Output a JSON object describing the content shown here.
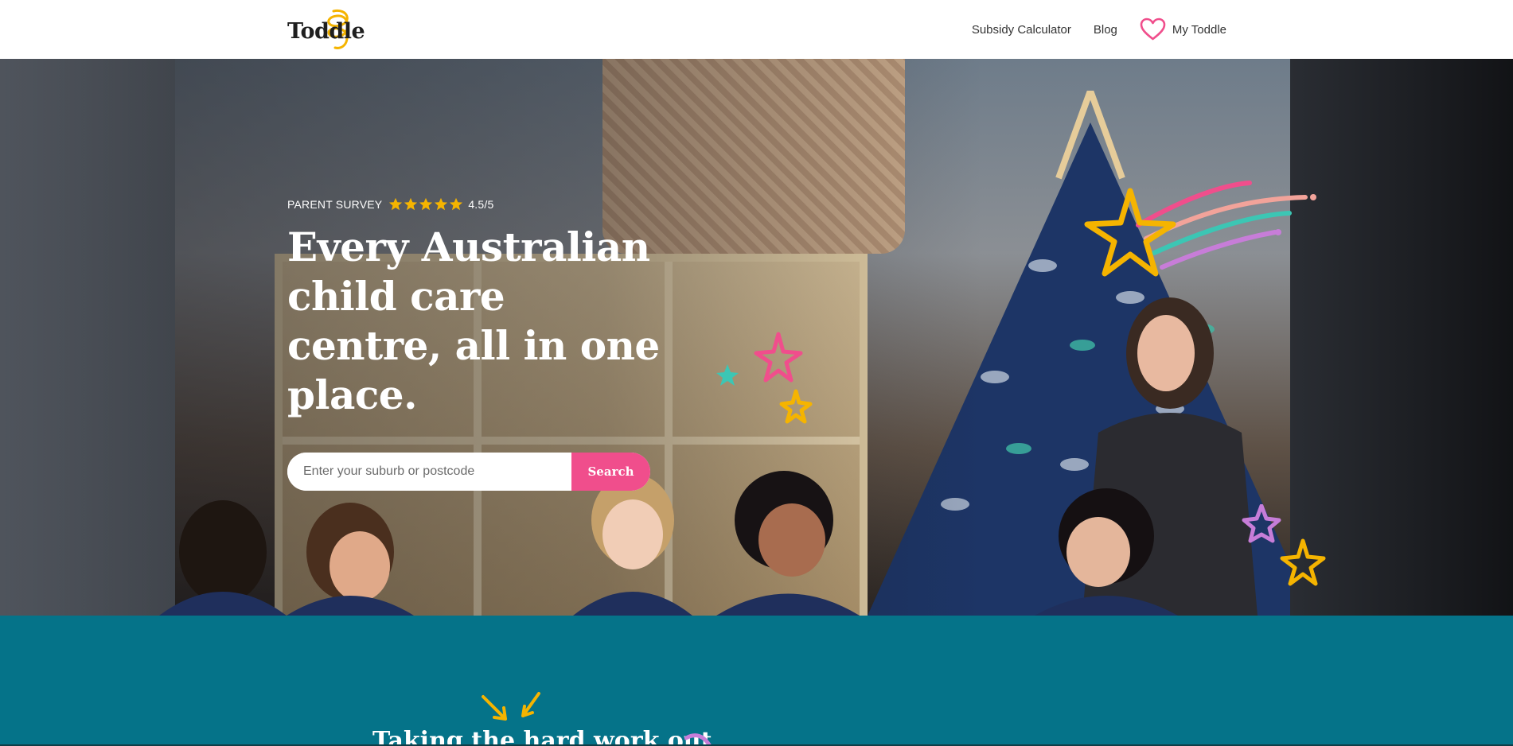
{
  "nav": {
    "logo_text": "Toddle",
    "links": [
      {
        "label": "Subsidy Calculator"
      },
      {
        "label": "Blog"
      }
    ],
    "my_toddle_label": "My Toddle",
    "heart_color": "#f04e8c"
  },
  "hero": {
    "survey_label": "PARENT SURVEY",
    "rating": "4.5/5",
    "rating_value": 4.5,
    "rating_max": 5,
    "star_color": "#f5b400",
    "headline": "Every Australian child care centre, all in one place.",
    "search": {
      "placeholder": "Enter your suburb or postcode",
      "button_label": "Search",
      "button_color": "#f04e8c"
    }
  },
  "section": {
    "title_partial": "Taking the hard work out",
    "background_color": "#057389"
  },
  "colors": {
    "accent_pink": "#f04e8c",
    "accent_yellow": "#f5b400",
    "accent_teal": "#3cc6b4",
    "accent_purple": "#c77dd8"
  }
}
